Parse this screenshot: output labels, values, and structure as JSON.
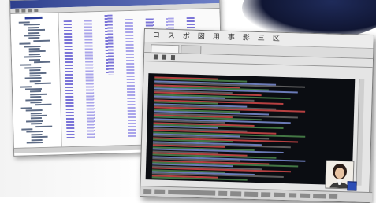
{
  "screenshot": {
    "description_none": true
  },
  "windows": {
    "tree_window": {
      "tree_rows": 46,
      "table_columns": 7
    },
    "terminal_window": {
      "menu_glyphs": [
        "ロ",
        "ス",
        "ボ",
        "図",
        "用",
        "事",
        "影",
        "三",
        "区"
      ],
      "tabs": 2,
      "terminal_lines": 54,
      "line_colors": {
        "primary": "#d64a4a",
        "secondary": "#4d8b4d",
        "tertiary": "#7c8fd6",
        "muted": "#6b6b6b"
      },
      "statusbar_cells": 12
    }
  },
  "colors": {
    "titlebar": "#2e3f8c",
    "table_primary": "#7b74d8",
    "table_secondary": "#a9a4ea",
    "terminal_bg": "#0b0d12",
    "badge": "#2c4db5"
  }
}
